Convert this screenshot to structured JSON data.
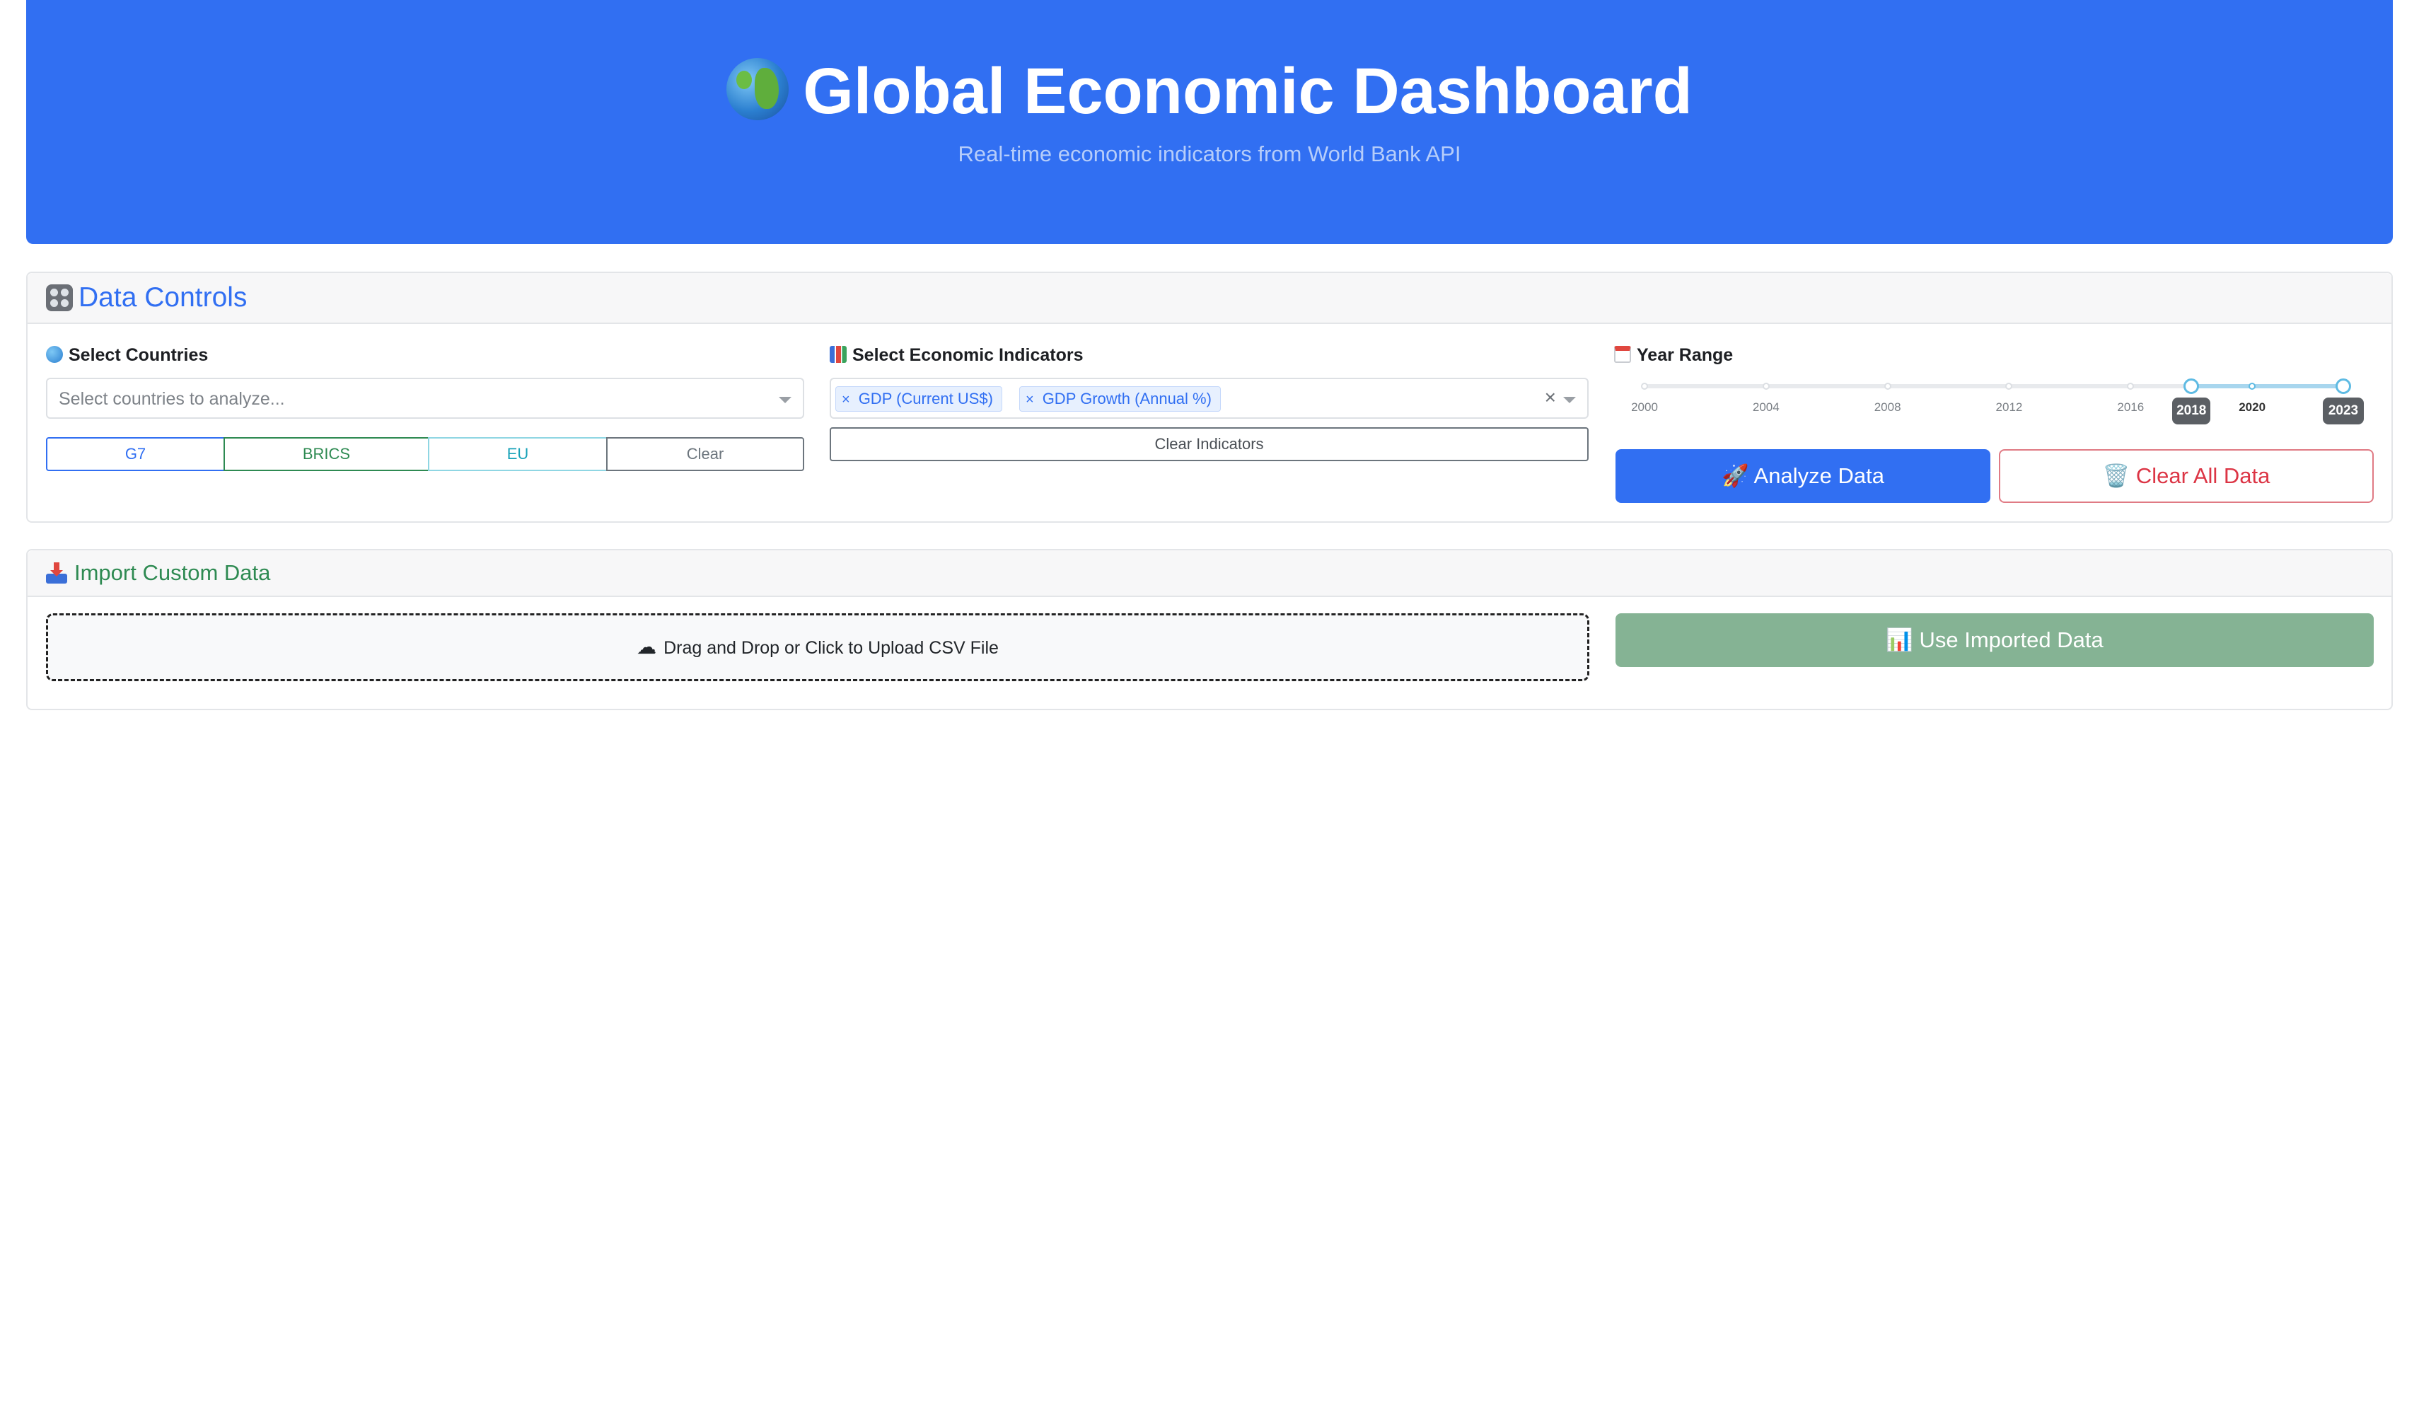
{
  "header": {
    "title": "Global Economic Dashboard",
    "subtitle": "Real-time economic indicators from World Bank API",
    "title_icon": "globe-icon"
  },
  "controls": {
    "title": "Data Controls",
    "countries": {
      "label": "Select Countries",
      "placeholder": "Select countries to analyze...",
      "groups": [
        "G7",
        "BRICS",
        "EU",
        "Clear"
      ]
    },
    "indicators": {
      "label": "Select Economic Indicators",
      "selected": [
        "GDP (Current US$)",
        "GDP Growth (Annual %)"
      ],
      "clear_label": "Clear Indicators"
    },
    "years": {
      "label": "Year Range",
      "min": 2000,
      "max": 2023,
      "start": 2018,
      "end": 2023,
      "ticks": [
        "2000",
        "2004",
        "2008",
        "2012",
        "2016",
        "2020"
      ],
      "start_label": "2018",
      "end_label": "2023"
    },
    "analyze_label": "🚀 Analyze Data",
    "clear_all_label": "🗑️ Clear All Data"
  },
  "import": {
    "title": "Import Custom Data",
    "drop_label": "Drag and Drop or Click to Upload CSV File",
    "use_label": "📊 Use Imported Data"
  },
  "colors": {
    "primary": "#316ff2",
    "success": "#2e8a52",
    "danger": "#dc3545",
    "info": "#17a2b8",
    "muted_success": "#85b394"
  }
}
